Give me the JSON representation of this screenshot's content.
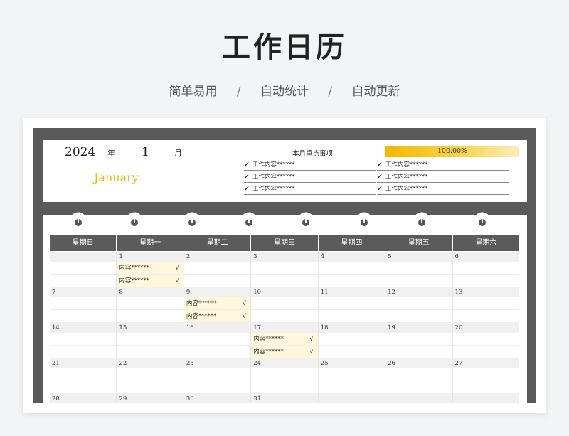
{
  "hero": {
    "title": "工作日历",
    "taglines": [
      "简单易用",
      "自动统计",
      "自动更新"
    ],
    "separator": "/"
  },
  "header": {
    "year": "2024",
    "year_unit": "年",
    "month": "1",
    "month_unit": "月",
    "month_name": "January",
    "focus_title": "本月重点事项",
    "progress_label": "100.00%",
    "progress_value": 1.0,
    "check_mark": "✓",
    "focus_items": [
      "工作内容******",
      "工作内容******",
      "工作内容******",
      "工作内容******",
      "工作内容******",
      "工作内容******"
    ]
  },
  "calendar": {
    "weekdays": [
      "星期日",
      "星期一",
      "星期二",
      "星期三",
      "星期四",
      "星期五",
      "星期六"
    ],
    "weeks": [
      [
        "",
        "1",
        "2",
        "3",
        "4",
        "5",
        "6"
      ],
      [
        "7",
        "8",
        "9",
        "10",
        "11",
        "12",
        "13"
      ],
      [
        "14",
        "15",
        "16",
        "17",
        "18",
        "19",
        "20"
      ],
      [
        "21",
        "22",
        "23",
        "24",
        "25",
        "26",
        "27"
      ],
      [
        "28",
        "29",
        "30",
        "31",
        "",
        "",
        ""
      ]
    ],
    "events": {
      "w0d1": [
        "内容******",
        "内容******"
      ],
      "w1d2": [
        "内容******",
        "内容******"
      ],
      "w2d3": [
        "内容******",
        "内容******"
      ]
    },
    "event_tick": "√"
  },
  "colors": {
    "accent": "#f2b705",
    "frame": "#5a5a5a",
    "event_bg": "#fff7dc"
  },
  "icons": [
    "binder-ring-icon",
    "check-icon"
  ]
}
